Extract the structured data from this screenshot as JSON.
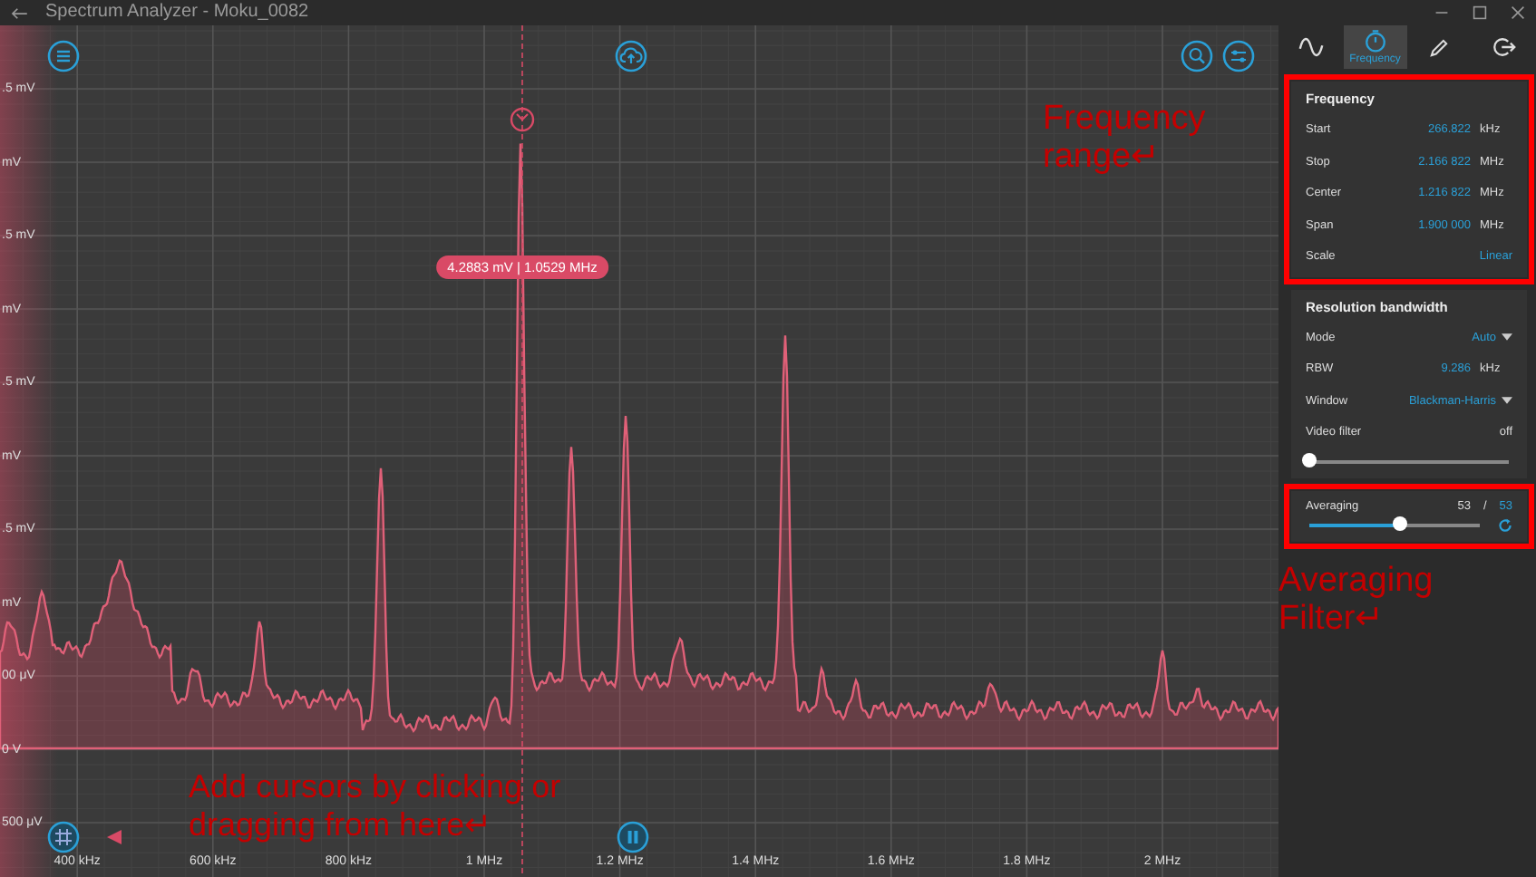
{
  "window": {
    "title": "Spectrum Analyzer - Moku_0082"
  },
  "plot": {
    "y_labels": [
      ".5 mV",
      "mV",
      ".5 mV",
      "mV",
      ".5 mV",
      "mV",
      ".5 mV",
      "mV",
      "00 μV",
      "0 V",
      "500 μV"
    ],
    "x_labels": [
      "400 kHz",
      "600 kHz",
      "800 kHz",
      "1 MHz",
      "1.2 MHz",
      "1.4 MHz",
      "1.6 MHz",
      "1.8 MHz",
      "2 MHz"
    ],
    "cursor": {
      "readout": "4.2883 mV | 1.0529 MHz"
    }
  },
  "tabs": [
    {
      "kind": "waveform",
      "selected": false
    },
    {
      "kind": "frequency",
      "label": "Frequency",
      "selected": true
    },
    {
      "kind": "measure",
      "selected": false
    },
    {
      "kind": "export",
      "selected": false
    }
  ],
  "frequency_panel": {
    "title": "Frequency",
    "highlighted": true,
    "rows": [
      {
        "label": "Start",
        "value": "266.822",
        "unit": "kHz"
      },
      {
        "label": "Stop",
        "value": "2.166 822",
        "unit": "MHz"
      },
      {
        "label": "Center",
        "value": "1.216 822",
        "unit": "MHz"
      },
      {
        "label": "Span",
        "value": "1.900 000",
        "unit": "MHz"
      },
      {
        "label": "Scale",
        "value": "Linear"
      }
    ]
  },
  "resolution_bandwidth": {
    "title": "Resolution bandwidth",
    "rows": [
      {
        "kind": "dropdown",
        "label": "Mode",
        "value": "Auto"
      },
      {
        "kind": "value",
        "label": "RBW",
        "value": "9.286",
        "unit": "kHz"
      },
      {
        "kind": "dropdown",
        "label": "Window",
        "value": "Blackman-Harris"
      },
      {
        "kind": "slider",
        "label": "Video filter",
        "value": "off",
        "level": 0
      }
    ]
  },
  "averaging": {
    "label": "Averaging",
    "current": "53",
    "separator": "/",
    "total": "53",
    "level": 0.53,
    "highlighted": true
  },
  "annotations": [
    {
      "text": "Frequency range↵"
    },
    {
      "text": "Averaging Filter↵"
    },
    {
      "text": "Add cursors by clicking or dragging from here↵"
    }
  ]
}
